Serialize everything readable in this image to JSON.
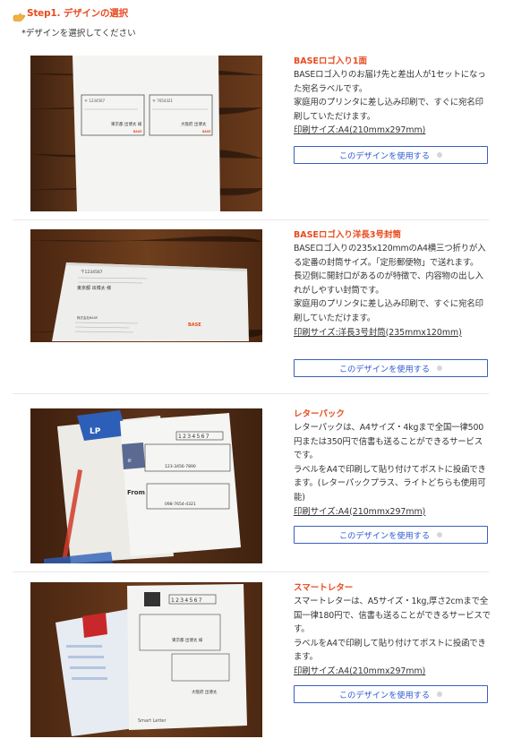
{
  "header": {
    "step_title": "Step1. デザインの選択",
    "instruction": "*デザインを選択してください"
  },
  "designs": [
    {
      "title": "BASEロゴ入り1面",
      "description": [
        "BASEロゴ入りのお届け先と差出人が1セットになった宛名ラベルです。",
        "家庭用のプリンタに差し込み印刷で、すぐに宛名印刷していただけます。"
      ],
      "print_size": "印刷サイズ:A4(210mmx297mm)",
      "button_label": "このデザインを使用する",
      "photo_text": {
        "postal_left": "〒 1234567",
        "name_left": "東京都 出博太 様",
        "postal_right": "〒 7654321",
        "name_right": "大阪府 出博太",
        "logo": "BASE"
      }
    },
    {
      "title": "BASEロゴ入り洋長3号封筒",
      "description": [
        "BASEロゴ入りの235x120mmのA4横三つ折りが入る定番の封筒サイズ。「定形郵便物」で送れます。",
        "長辺側に開封口があるのが特徴で、内容物の出し入れがしやすい封筒です。",
        "家庭用のプリンタに差し込み印刷で、すぐに宛名印刷していただけます。"
      ],
      "print_size": "印刷サイズ:洋長3号封筒(235mmx120mm)",
      "button_label": "このデザインを使用する",
      "photo_text": {
        "postal": "〒1234567",
        "name": "東京都 出博太 様",
        "sender": "株式会社BASE",
        "logo": "BASE"
      }
    },
    {
      "title": "レターパック",
      "description": [
        "レターパックは、A4サイズ・4kgまで全国一律500円または350円で信書も送ることができるサービスです。",
        "ラベルをA4で印刷して貼り付けてポストに投函できます。(レターパックプラス、ライトどちらも使用可能)"
      ],
      "print_size": "印刷サイズ:A4(210mmx297mm)",
      "button_label": "このデザインを使用する",
      "photo_text": {
        "postal_boxes": "1234567",
        "phone_to": "123-3456-7890",
        "phone_from": "098-7654-4321",
        "from": "From",
        "brand": "LP"
      }
    },
    {
      "title": "スマートレター",
      "description": [
        "スマートレターは、A5サイズ・1kg,厚さ2cmまで全国一律180円で、信書も送ることができるサービスです。",
        "ラベルをA4で印刷して貼り付けてポストに投函できます。"
      ],
      "print_size": "印刷サイズ:A4(210mmx297mm)",
      "button_label": "このデザインを使用する",
      "photo_text": {
        "postal_boxes": "1234567",
        "name_to": "東京都 出博太 様",
        "name_from": "大阪府 出博太",
        "brand": "Smart Letter"
      }
    }
  ],
  "colors": {
    "accent": "#e94b1f",
    "button_border": "#3b5fc0",
    "button_text": "#2f5bd0",
    "divider": "#e6e6e6",
    "wood": "#5a3319"
  },
  "icons": {
    "step_icon": "pointing-hand-icon",
    "button_icon": "radio-dot-icon"
  }
}
